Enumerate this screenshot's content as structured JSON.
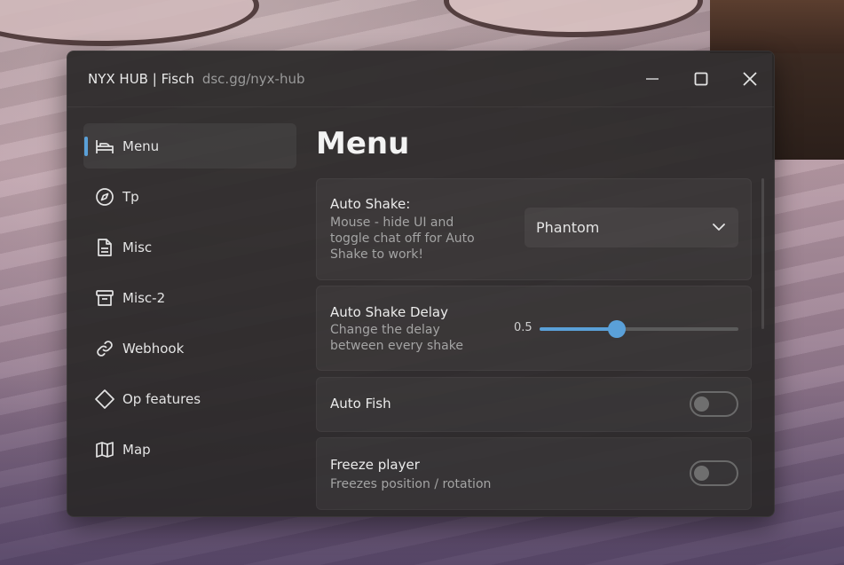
{
  "window": {
    "title": "NYX HUB | Fisch",
    "subtitle": "dsc.gg/nyx-hub"
  },
  "sidebar": {
    "items": [
      {
        "label": "Menu",
        "icon": "bed-icon",
        "active": true
      },
      {
        "label": "Tp",
        "icon": "compass-icon"
      },
      {
        "label": "Misc",
        "icon": "document-icon"
      },
      {
        "label": "Misc-2",
        "icon": "archive-icon"
      },
      {
        "label": "Webhook",
        "icon": "link-icon"
      },
      {
        "label": "Op features",
        "icon": "diamond-icon"
      },
      {
        "label": "Map",
        "icon": "map-icon"
      }
    ]
  },
  "main": {
    "title": "Menu",
    "auto_shake": {
      "title": "Auto Shake:",
      "desc_lines": [
        "Mouse - hide UI and",
        "toggle chat off for Auto",
        "Shake to work!"
      ],
      "dropdown_value": "Phantom"
    },
    "auto_shake_delay": {
      "title": "Auto Shake Delay",
      "desc_lines": [
        "Change the delay",
        "between every shake"
      ],
      "value_label": "0.5",
      "fill_fraction": 0.39
    },
    "auto_fish": {
      "title": "Auto Fish",
      "enabled": false
    },
    "freeze_player": {
      "title": "Freeze player",
      "desc": "Freezes position / rotation",
      "enabled": false
    }
  },
  "colors": {
    "accent": "#5aa0d8",
    "window_bg": "#2a2828"
  }
}
